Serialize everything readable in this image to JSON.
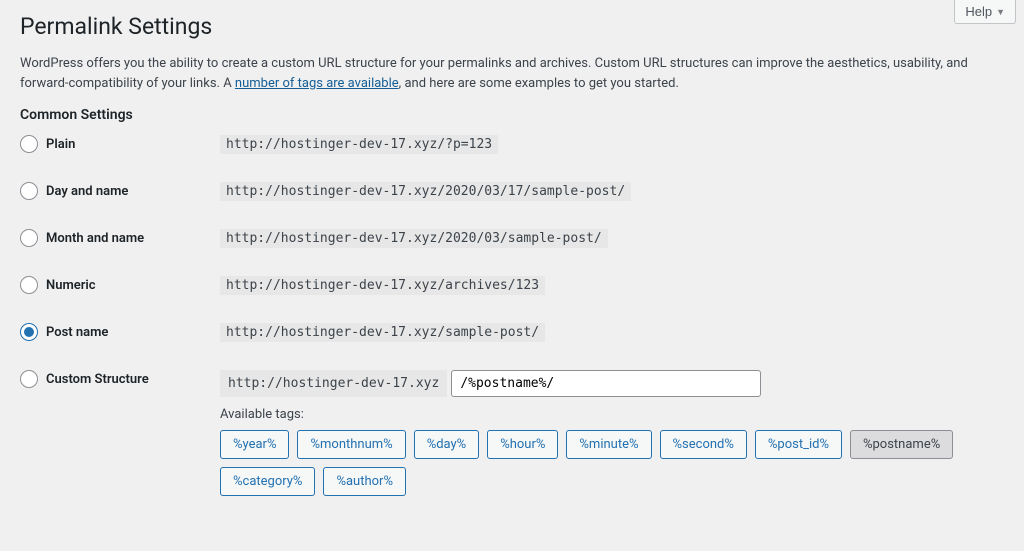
{
  "help": {
    "label": "Help"
  },
  "page_title": "Permalink Settings",
  "intro": {
    "text_before": "WordPress offers you the ability to create a custom URL structure for your permalinks and archives. Custom URL structures can improve the aesthetics, usability, and forward-compatibility of your links. A ",
    "link_text": "number of tags are available",
    "text_after": ", and here are some examples to get you started."
  },
  "section_title": "Common Settings",
  "rows": [
    {
      "label": "Plain",
      "example": "http://hostinger-dev-17.xyz/?p=123",
      "checked": false
    },
    {
      "label": "Day and name",
      "example": "http://hostinger-dev-17.xyz/2020/03/17/sample-post/",
      "checked": false
    },
    {
      "label": "Month and name",
      "example": "http://hostinger-dev-17.xyz/2020/03/sample-post/",
      "checked": false
    },
    {
      "label": "Numeric",
      "example": "http://hostinger-dev-17.xyz/archives/123",
      "checked": false
    },
    {
      "label": "Post name",
      "example": "http://hostinger-dev-17.xyz/sample-post/",
      "checked": true
    }
  ],
  "custom": {
    "label": "Custom Structure",
    "prefix": "http://hostinger-dev-17.xyz",
    "value": "/%postname%/",
    "checked": false
  },
  "available_tags_label": "Available tags:",
  "tags": [
    {
      "text": "%year%",
      "active": false
    },
    {
      "text": "%monthnum%",
      "active": false
    },
    {
      "text": "%day%",
      "active": false
    },
    {
      "text": "%hour%",
      "active": false
    },
    {
      "text": "%minute%",
      "active": false
    },
    {
      "text": "%second%",
      "active": false
    },
    {
      "text": "%post_id%",
      "active": false
    },
    {
      "text": "%postname%",
      "active": true
    },
    {
      "text": "%category%",
      "active": false
    },
    {
      "text": "%author%",
      "active": false
    }
  ]
}
